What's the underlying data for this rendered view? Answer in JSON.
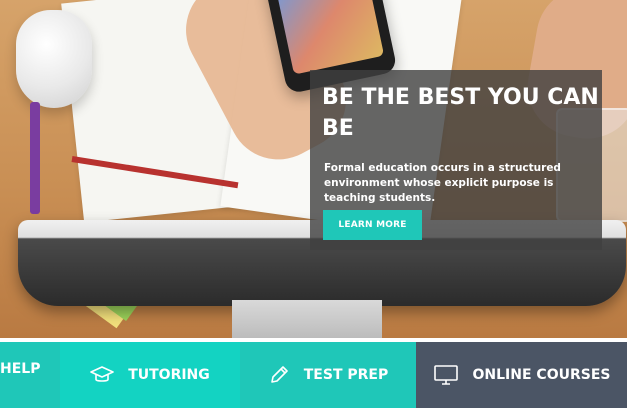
{
  "hero": {
    "title": "BE THE BEST YOU CAN BE",
    "description": "Formal education occurs in a structured environment whose explicit purpose is teaching students.",
    "cta_label": "LEARN MORE"
  },
  "services": {
    "help_label": "HELP",
    "items": [
      {
        "label": "TUTORING",
        "icon": "graduation-cap-icon"
      },
      {
        "label": "TEST PREP",
        "icon": "pencil-icon"
      },
      {
        "label": "ONLINE COURSES",
        "icon": "monitor-icon"
      }
    ]
  },
  "colors": {
    "teal": "#1fc7b8",
    "teal_light": "#13d3c2",
    "slate": "#4b5565",
    "overlay": "rgba(64,64,64,0.80)"
  }
}
